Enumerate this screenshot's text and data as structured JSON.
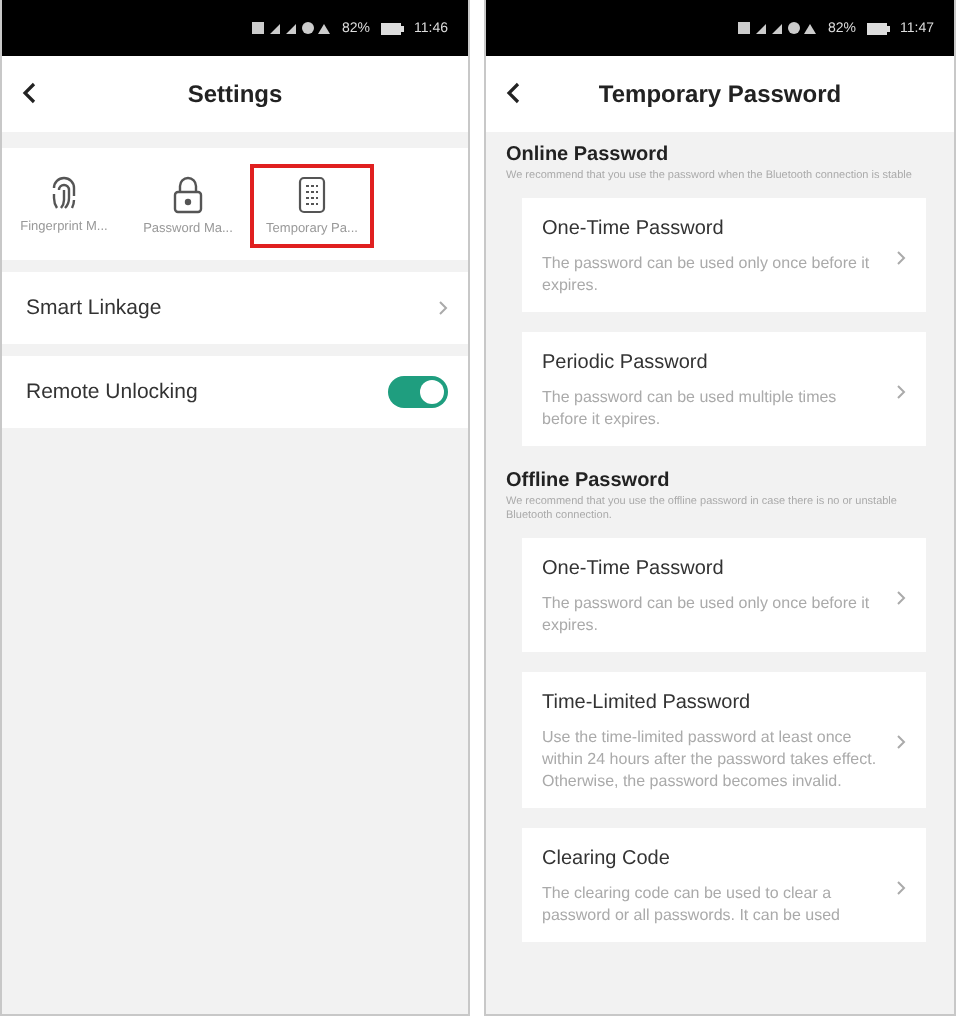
{
  "screens": [
    {
      "status_bar": {
        "battery": "82%",
        "time": "11:46"
      },
      "header": {
        "title": "Settings"
      },
      "tiles": [
        {
          "label": "Fingerprint M...",
          "kind": "fingerprint",
          "selected": false
        },
        {
          "label": "Password Ma...",
          "kind": "lock",
          "selected": false
        },
        {
          "label": "Temporary Pa...",
          "kind": "keypad",
          "selected": true
        }
      ],
      "rows": [
        {
          "label": "Smart Linkage",
          "kind": "link"
        },
        {
          "label": "Remote Unlocking",
          "kind": "toggle",
          "on": true
        }
      ]
    },
    {
      "status_bar": {
        "battery": "82%",
        "time": "11:47"
      },
      "header": {
        "title": "Temporary Password"
      },
      "sections": [
        {
          "title": "Online Password",
          "note": "We recommend that you use the password when the Bluetooth connection is stable",
          "items": [
            {
              "title": "One-Time Password",
              "description": "The password can be used only once before it expires."
            },
            {
              "title": "Periodic Password",
              "description": "The password can be used multiple times before it expires."
            }
          ]
        },
        {
          "title": "Offline Password",
          "note": "We recommend that you use the offline password in case there is no or unstable Bluetooth connection.",
          "items": [
            {
              "title": "One-Time Password",
              "description": "The password can be used only once before it expires."
            },
            {
              "title": "Time-Limited Password",
              "description": "Use the time-limited password at least once within 24 hours after the password takes effect. Otherwise, the password becomes invalid."
            },
            {
              "title": "Clearing Code",
              "description": "The clearing code can be used to clear a password or all passwords. It can be used"
            }
          ]
        }
      ]
    }
  ]
}
